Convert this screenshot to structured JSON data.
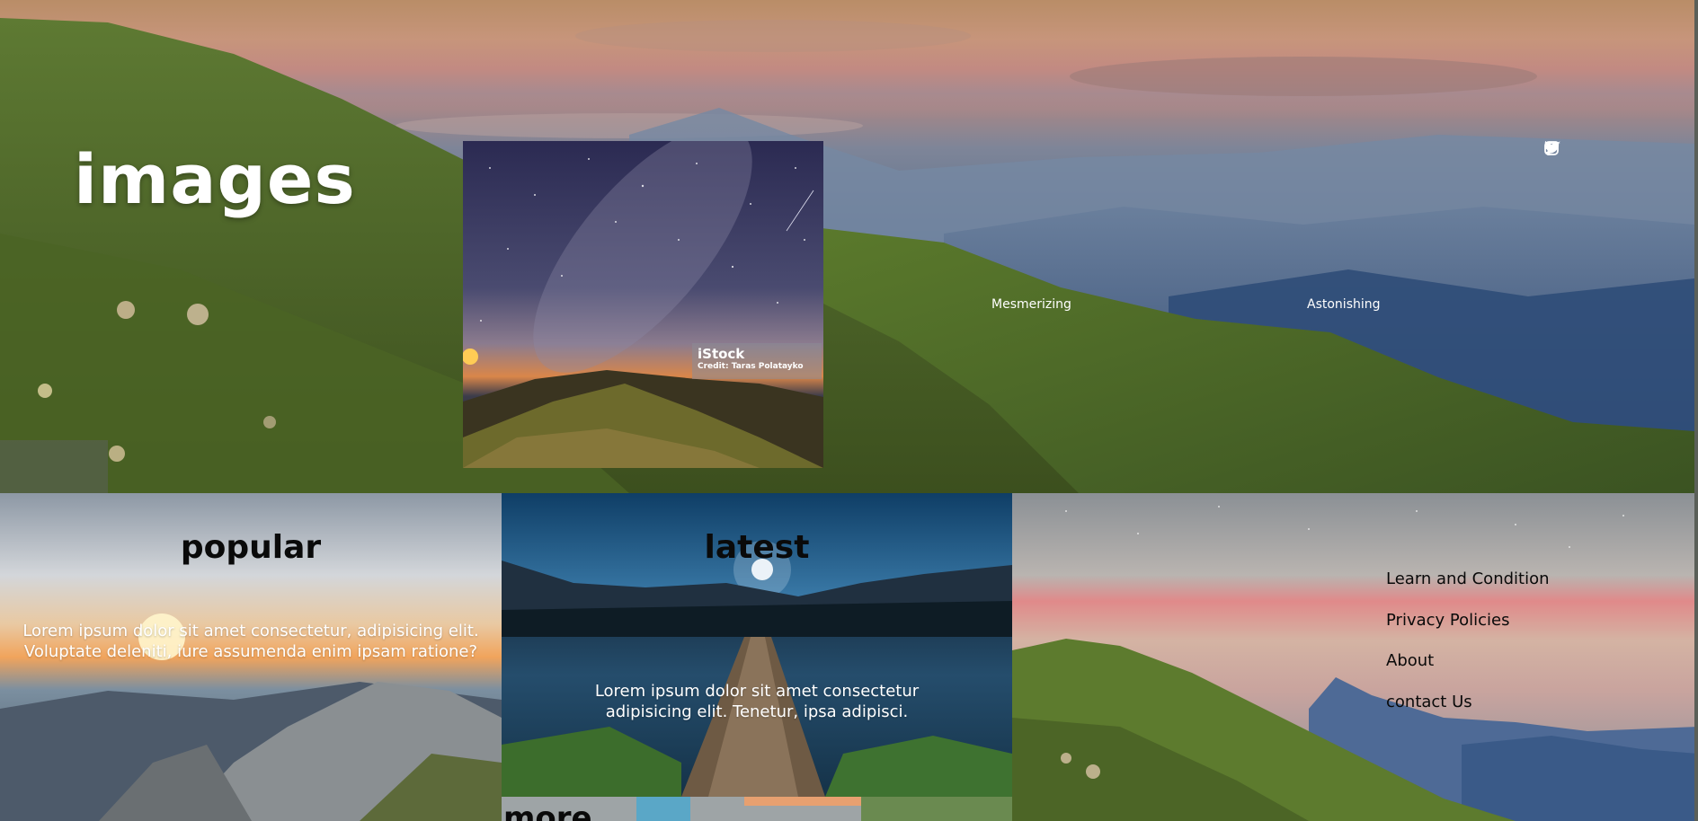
{
  "hero": {
    "title": "images",
    "social": [
      {
        "icon": "twitter-icon"
      },
      {
        "icon": "instagram-icon"
      },
      {
        "icon": "facebook-icon"
      }
    ],
    "gallery": {
      "watermark_brand": "iStock",
      "watermark_credit": "Credit: Taras Polatayko"
    },
    "tabs": [
      {
        "label": "Mesmerizing"
      },
      {
        "label": "Astonishing"
      }
    ]
  },
  "sections": {
    "popular": {
      "heading": "popular",
      "text": "Lorem ipsum dolor sit amet consectetur, adipisicing elit. Voluptate deleniti, iure assumenda enim ipsam ratione?"
    },
    "latest": {
      "heading": "latest",
      "text": "Lorem ipsum dolor sit amet consectetur adipisicing elit. Tenetur, ipsa adipisci."
    },
    "more": {
      "heading": "more"
    }
  },
  "footer": {
    "links": [
      {
        "label": "Learn and Condition"
      },
      {
        "label": "Privacy Policies"
      },
      {
        "label": "About"
      },
      {
        "label": "contact Us"
      }
    ]
  },
  "colors": {
    "text_light": "#ffffff",
    "text_dark": "#0a0a0a",
    "grass": "#4f6b2a",
    "sky_warm": "#c7957b",
    "sky_blue": "#3a5a86"
  }
}
